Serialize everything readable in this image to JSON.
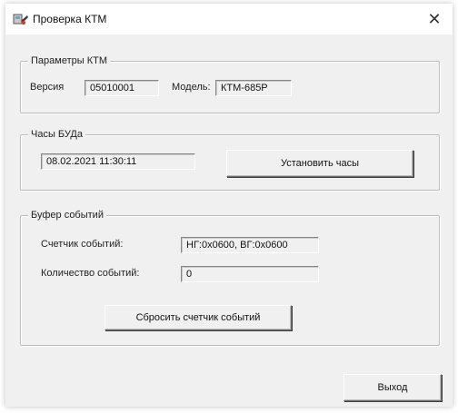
{
  "window": {
    "title": "Проверка КТМ",
    "close_symbol": "✕"
  },
  "ktm_params": {
    "legend": "Параметры КТМ",
    "version_label": "Версия",
    "version_value": "05010001",
    "model_label": "Модель:",
    "model_value": "КТМ-685Р"
  },
  "clock": {
    "legend": "Часы БУДа",
    "datetime_value": "08.02.2021 11:30:11",
    "set_button_label": "Установить часы"
  },
  "event_buffer": {
    "legend": "Буфер событий",
    "counter_label": "Счетчик событий:",
    "counter_value": "НГ:0x0600,  ВГ:0x0600",
    "count_label": "Количество событий:",
    "count_value": "0",
    "reset_button_label": "Сбросить счетчик событий"
  },
  "footer": {
    "exit_button_label": "Выход"
  }
}
